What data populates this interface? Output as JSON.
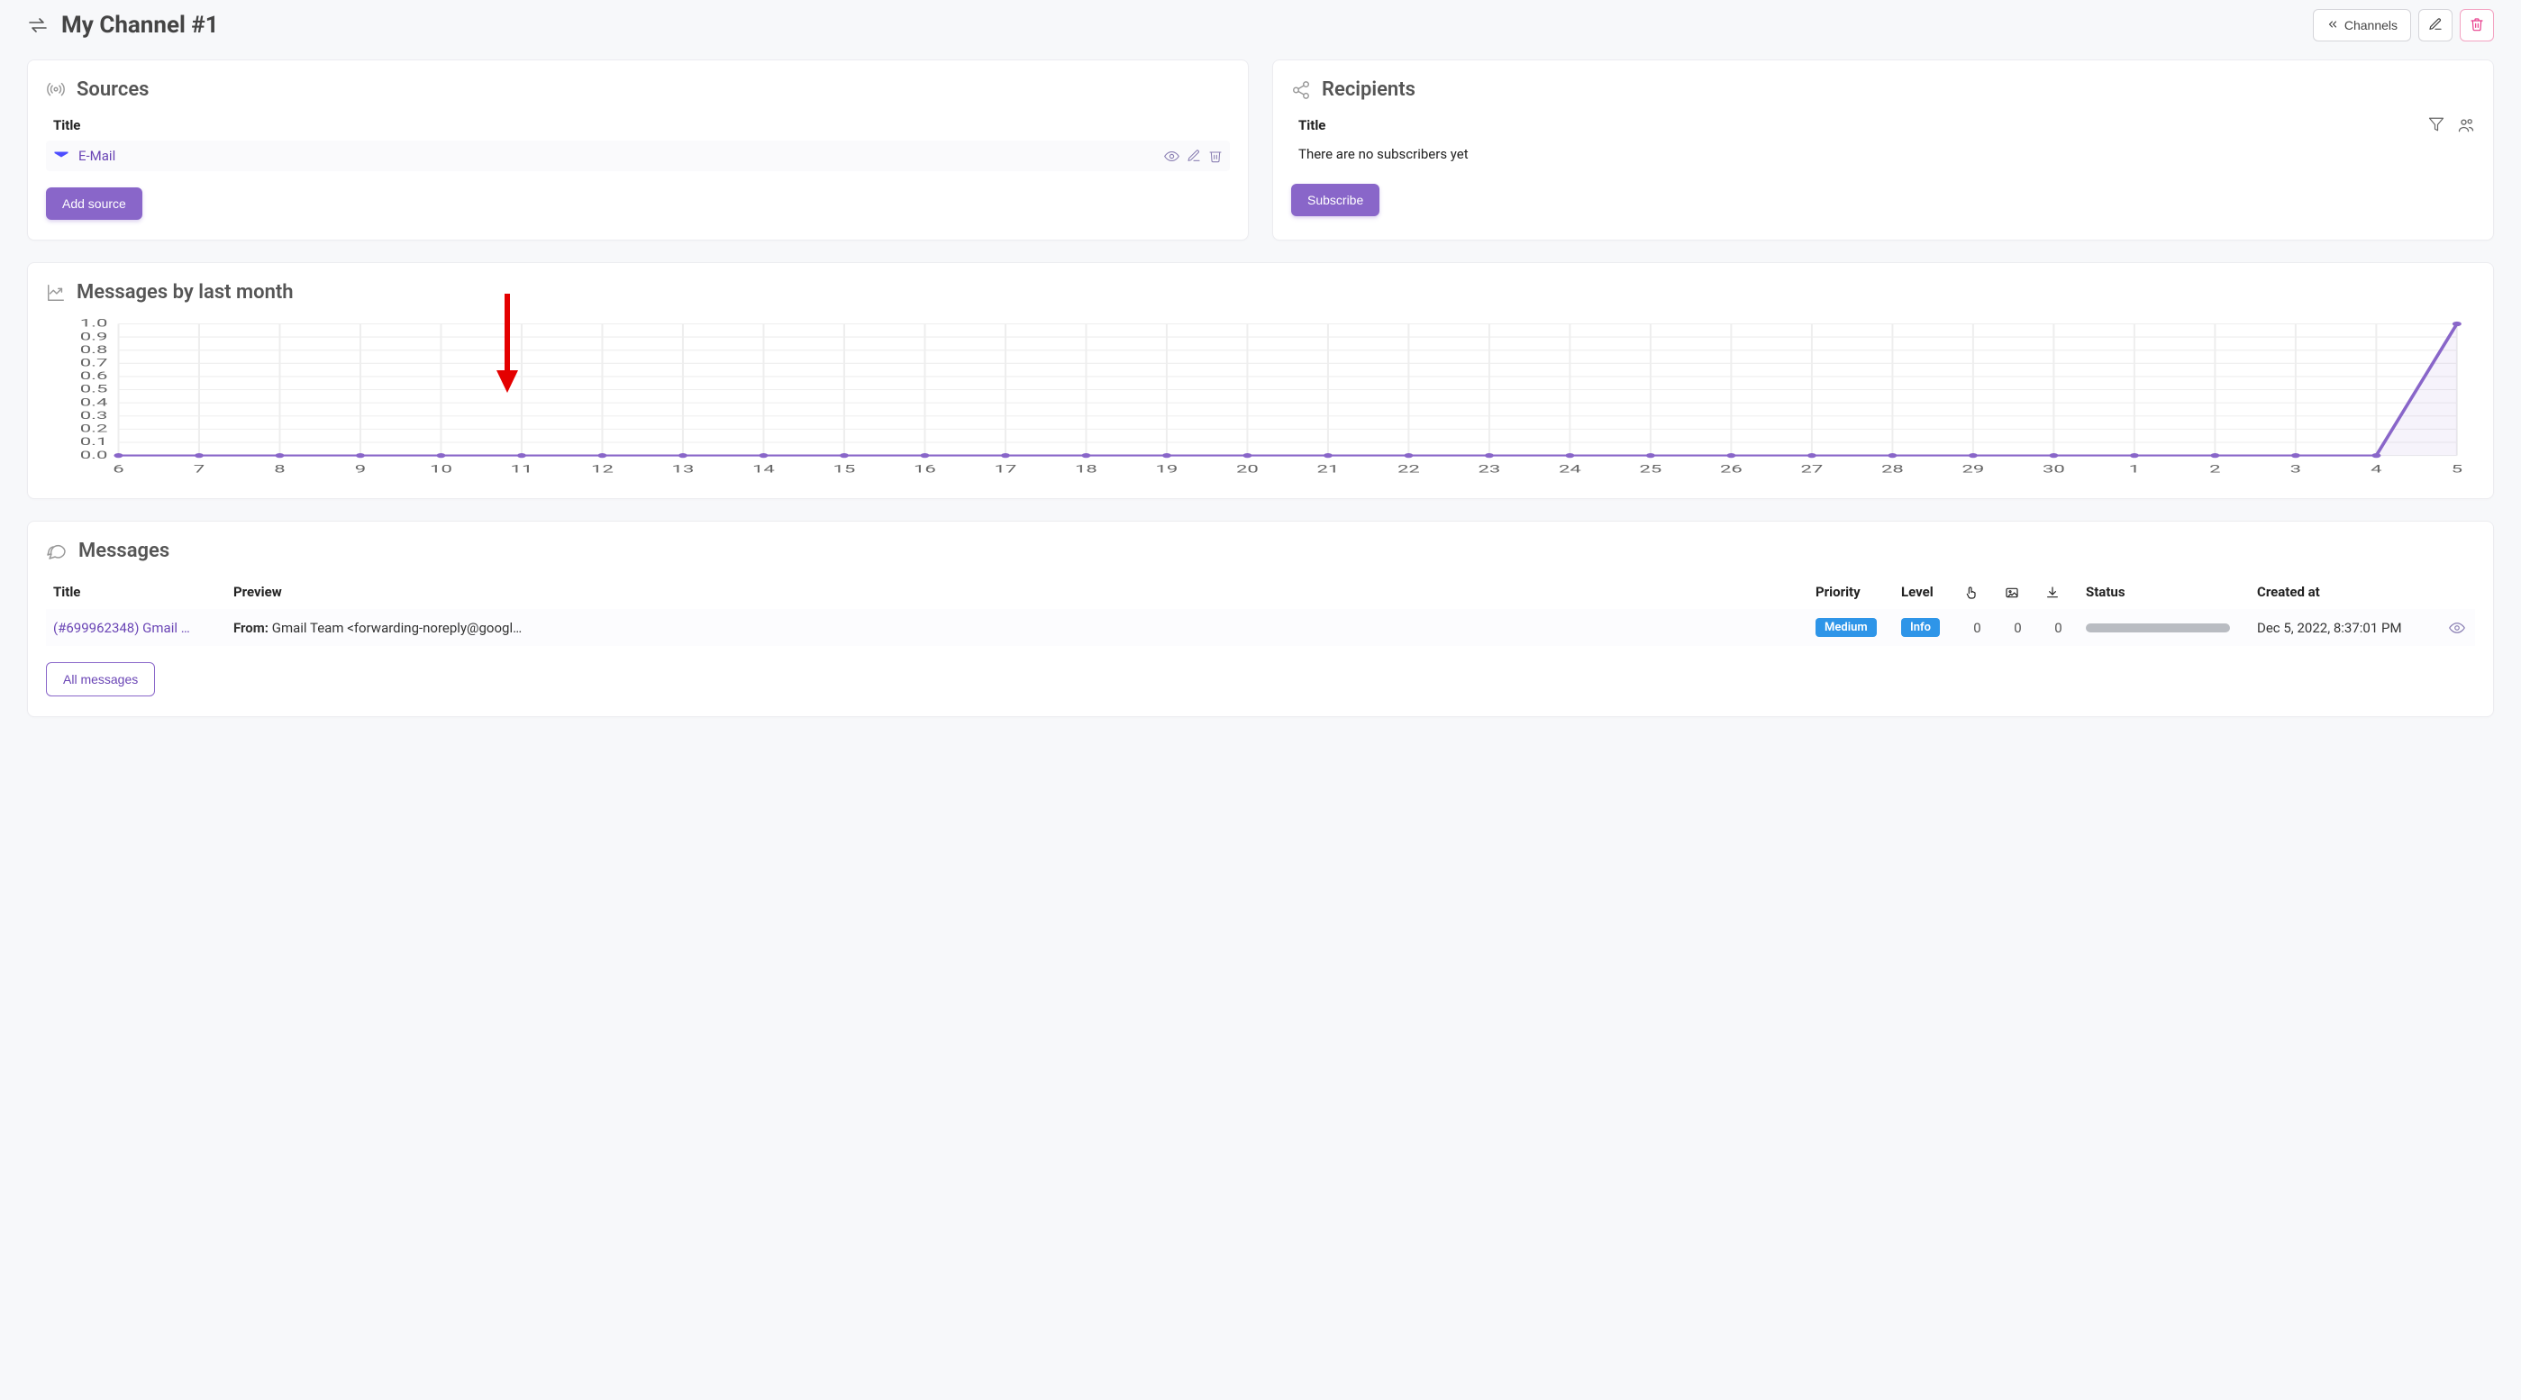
{
  "header": {
    "title": "My Channel #1",
    "back_label": "Channels"
  },
  "sources": {
    "heading": "Sources",
    "column_title": "Title",
    "items": [
      {
        "icon": "mail-icon",
        "title": "E-Mail"
      }
    ],
    "add_button": "Add source"
  },
  "recipients": {
    "heading": "Recipients",
    "column_title": "Title",
    "empty": "There are no subscribers yet",
    "subscribe_button": "Subscribe"
  },
  "chart": {
    "heading": "Messages by last month"
  },
  "chart_data": {
    "type": "line",
    "title": "Messages by last month",
    "xlabel": "",
    "ylabel": "",
    "ylim": [
      0,
      1.0
    ],
    "y_ticks": [
      0,
      0.1,
      0.2,
      0.3,
      0.4,
      0.5,
      0.6,
      0.7,
      0.8,
      0.9,
      1.0
    ],
    "categories": [
      "6",
      "7",
      "8",
      "9",
      "10",
      "11",
      "12",
      "13",
      "14",
      "15",
      "16",
      "17",
      "18",
      "19",
      "20",
      "21",
      "22",
      "23",
      "24",
      "25",
      "26",
      "27",
      "28",
      "29",
      "30",
      "1",
      "2",
      "3",
      "4",
      "5"
    ],
    "values": [
      0,
      0,
      0,
      0,
      0,
      0,
      0,
      0,
      0,
      0,
      0,
      0,
      0,
      0,
      0,
      0,
      0,
      0,
      0,
      0,
      0,
      0,
      0,
      0,
      0,
      0,
      0,
      0,
      0,
      1
    ]
  },
  "messages": {
    "heading": "Messages",
    "columns": {
      "title": "Title",
      "preview": "Preview",
      "priority": "Priority",
      "level": "Level",
      "status": "Status",
      "created": "Created at"
    },
    "rows": [
      {
        "title": "(#699962348) Gmail …",
        "preview_label": "From:",
        "preview_value": "Gmail Team <forwarding-noreply@googl…",
        "priority": "Medium",
        "level": "Info",
        "count1": "0",
        "count2": "0",
        "count3": "0",
        "created": "Dec 5, 2022, 8:37:01 PM"
      }
    ],
    "all_button": "All messages"
  }
}
